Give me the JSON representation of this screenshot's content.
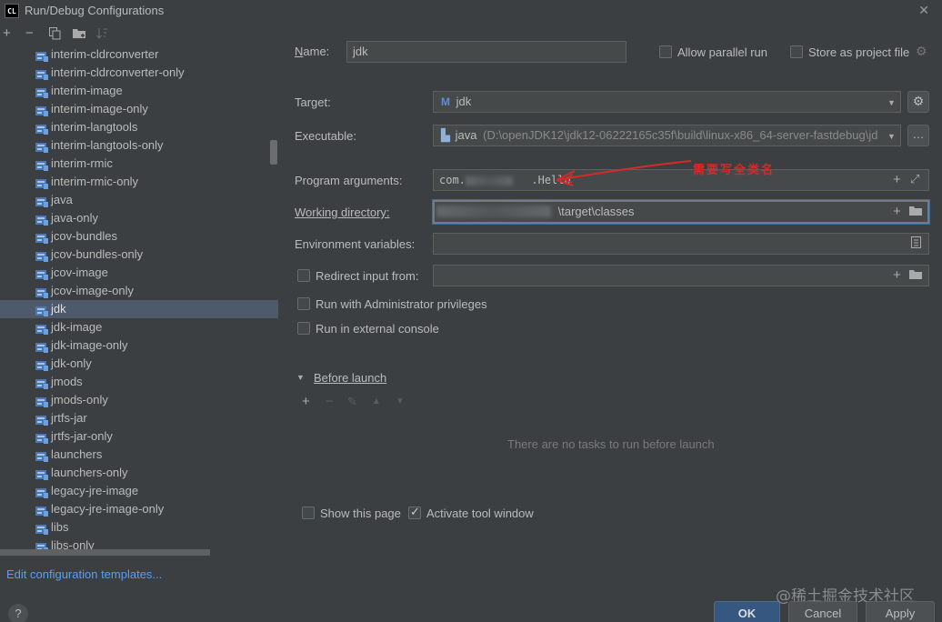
{
  "window": {
    "title": "Run/Debug Configurations",
    "logo": "CL"
  },
  "toolbar": {
    "add": "+",
    "remove": "−",
    "copy_icon": "copy-icon",
    "folder_icon": "folder-add-icon",
    "sort_icon": "sort-icon"
  },
  "tree": {
    "items": [
      "interim-cldrconverter",
      "interim-cldrconverter-only",
      "interim-image",
      "interim-image-only",
      "interim-langtools",
      "interim-langtools-only",
      "interim-rmic",
      "interim-rmic-only",
      "java",
      "java-only",
      "jcov-bundles",
      "jcov-bundles-only",
      "jcov-image",
      "jcov-image-only",
      "jdk",
      "jdk-image",
      "jdk-image-only",
      "jdk-only",
      "jmods",
      "jmods-only",
      "jrtfs-jar",
      "jrtfs-jar-only",
      "launchers",
      "launchers-only",
      "legacy-jre-image",
      "legacy-jre-image-only",
      "libs",
      "libs-only"
    ],
    "selected": "jdk"
  },
  "footer_left": {
    "edit_templates": "Edit configuration templates...",
    "help": "?"
  },
  "form": {
    "name_label": "Name:",
    "name_value": "jdk",
    "allow_parallel": "Allow parallel run",
    "store_project": "Store as project file",
    "target_label": "Target:",
    "target_value": "jdk",
    "executable_label": "Executable:",
    "executable_name": "java",
    "executable_path": "(D:\\openJDK12\\jdk12-06222165c35f\\build\\linux-x86_64-server-fastdebug\\jd",
    "program_args_label": "Program arguments:",
    "program_args_prefix": "com.",
    "program_args_suffix": ".Hello",
    "annotation": "需要写全类名",
    "working_dir_label": "Working directory:",
    "working_dir_value": "\\target\\classes",
    "env_label": "Environment variables:",
    "redirect_label": "Redirect input from:",
    "admin_label": "Run with Administrator privileges",
    "external_console_label": "Run in external console",
    "before_launch": "Before launch",
    "no_tasks": "There are no tasks to run before launch",
    "show_page": "Show this page",
    "activate_tool": "Activate tool window"
  },
  "buttons": {
    "ok": "OK",
    "cancel": "Cancel",
    "apply": "Apply"
  },
  "watermark": "@稀土掘金技术社区",
  "colors": {
    "bg": "#3c3f41",
    "selection": "#4e5a6b",
    "link": "#589df6",
    "annotation": "#d42a2a"
  }
}
